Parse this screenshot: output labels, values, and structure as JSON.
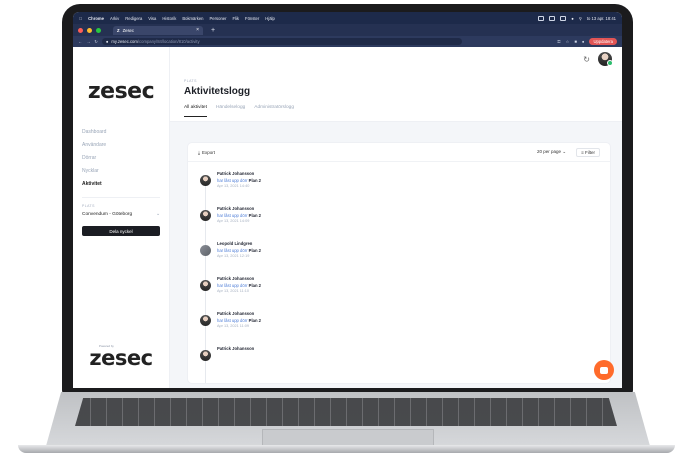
{
  "menubar": {
    "app": "Chrome",
    "items": [
      "Arkiv",
      "Redigera",
      "Visa",
      "Historik",
      "Bokmärken",
      "Personer",
      "Flik",
      "Fönster",
      "Hjälp"
    ],
    "clock": "to 13 apr. 18:41"
  },
  "browser": {
    "tab_title": "Zesec",
    "url_host": "my.zesec.com",
    "url_path": "/company/84/location/810/activity",
    "update_label": "Uppdatera"
  },
  "sidebar": {
    "logo": "zesec",
    "nav": [
      {
        "label": "Dashboard",
        "active": false
      },
      {
        "label": "Användare",
        "active": false
      },
      {
        "label": "Dörrar",
        "active": false
      },
      {
        "label": "Nycklar",
        "active": false
      },
      {
        "label": "Aktivitet",
        "active": true
      }
    ],
    "place_label": "PLATS",
    "place_value": "Convendum - Göteborg",
    "share_button": "Dela nyckel",
    "powered_by": "Powered by",
    "logo_bottom": "zesec"
  },
  "header": {
    "kicker": "PLATS",
    "title": "Aktivitetslogg",
    "tabs": [
      {
        "label": "All aktivitet",
        "active": true
      },
      {
        "label": "Händelselogg",
        "active": false
      },
      {
        "label": "Administratörslogg",
        "active": false
      }
    ]
  },
  "card": {
    "export_label": "Export",
    "per_page": "20 per page",
    "filter_label": "Filter"
  },
  "feed": [
    {
      "name": "Patrick Johansson",
      "action": "har låst upp dörr",
      "target": "Plan 2",
      "time": "Apr 13, 2021 14:40"
    },
    {
      "name": "Patrick Johansson",
      "action": "har låst upp dörr",
      "target": "Plan 2",
      "time": "Apr 13, 2021 14:09"
    },
    {
      "name": "Leopold Lindgren",
      "action": "har låst upp dörr",
      "target": "Plan 2",
      "time": "Apr 13, 2021 12:19"
    },
    {
      "name": "Patrick Johansson",
      "action": "har låst upp dörr",
      "target": "Plan 2",
      "time": "Apr 13, 2021 11:10"
    },
    {
      "name": "Patrick Johansson",
      "action": "har låst upp dörr",
      "target": "Plan 2",
      "time": "Apr 13, 2021 11:09"
    },
    {
      "name": "Patrick Johansson",
      "action": "",
      "target": "",
      "time": ""
    }
  ],
  "colors": {
    "accent_link": "#4b7bd6",
    "chat_fab": "#ff6b2b",
    "update_badge": "#e25555",
    "dark_button": "#1b1d23"
  }
}
